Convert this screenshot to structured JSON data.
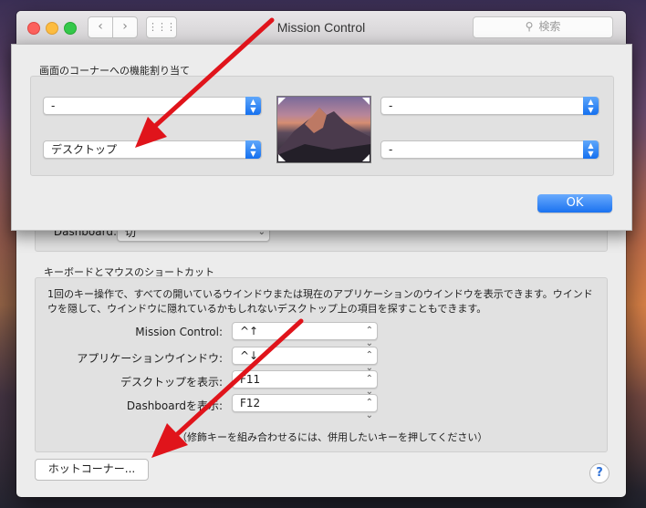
{
  "window": {
    "title": "Mission Control",
    "search_placeholder": "検索",
    "nav_back": "‹",
    "nav_forward": "›",
    "grid": "⋮⋮⋮"
  },
  "sheet": {
    "section_label": "画面のコーナーへの機能割り当て",
    "top_left": "-",
    "bottom_left": "デスクトップ",
    "top_right": "-",
    "bottom_right": "-",
    "ok_label": "OK"
  },
  "dashboard_partial": {
    "label": "Dashboard:",
    "value": "切"
  },
  "shortcuts": {
    "section_label": "キーボードとマウスのショートカット",
    "description": "1回のキー操作で、すべての開いているウインドウまたは現在のアプリケーションのウインドウを表示できます。ウインドウを隠して、ウインドウに隠れているかもしれないデスクトップ上の項目を探すこともできます。",
    "rows": [
      {
        "label": "Mission Control:",
        "value": "^↑"
      },
      {
        "label": "アプリケーションウインドウ:",
        "value": "^↓"
      },
      {
        "label": "デスクトップを表示:",
        "value": "F11"
      },
      {
        "label": "Dashboardを表示:",
        "value": "F12"
      }
    ],
    "footnote": "（修飾キーを組み合わせるには、併用したいキーを押してください）"
  },
  "hot_corners_button": "ホットコーナー...",
  "help_label": "?",
  "colors": {
    "accent": "#1a72f0",
    "arrow": "#e0141b"
  }
}
